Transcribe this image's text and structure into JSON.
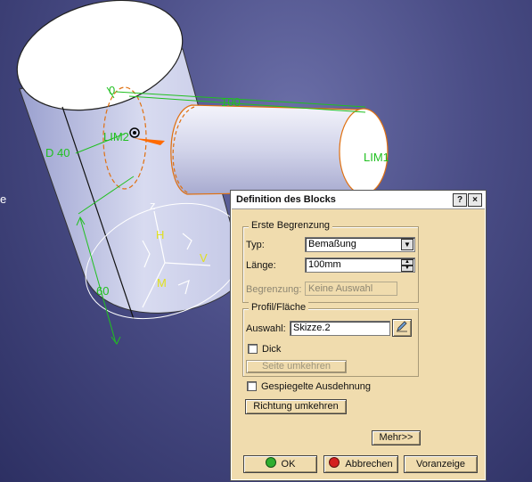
{
  "viewport": {
    "labels": {
      "dim_length": "100",
      "dim_zero": "0",
      "diameter": "D 40",
      "lim2": "LIM2",
      "lim1": "LIM1",
      "dim_sixty": "60",
      "axis_z": "z",
      "axis_h": "H",
      "axis_v": "V",
      "axis_m": "M",
      "left_edge_char": "e"
    }
  },
  "dialog": {
    "title": "Definition des Blocks",
    "help_button": "?",
    "close_button": "×",
    "first_limit": {
      "group_title": "Erste Begrenzung",
      "type_label": "Typ:",
      "type_value": "Bemaßung",
      "length_label": "Länge:",
      "length_value": "100mm",
      "limit_label": "Begrenzung:",
      "limit_value": "Keine Auswahl"
    },
    "profile": {
      "group_title": "Profil/Fläche",
      "selection_label": "Auswahl:",
      "selection_value": "Skizze.2",
      "thick_label": "Dick",
      "reverse_side_button": "Seite umkehren"
    },
    "mirrored_extent_label": "Gespiegelte Ausdehnung",
    "reverse_direction_button": "Richtung umkehren",
    "more_button": "Mehr>>",
    "ok_button": "OK",
    "cancel_button": "Abbrechen",
    "preview_button": "Voranzeige",
    "colors": {
      "ok_dot": "#2fae2f",
      "cancel_dot": "#d42020",
      "dialog_bg": "#f0dcae"
    }
  }
}
